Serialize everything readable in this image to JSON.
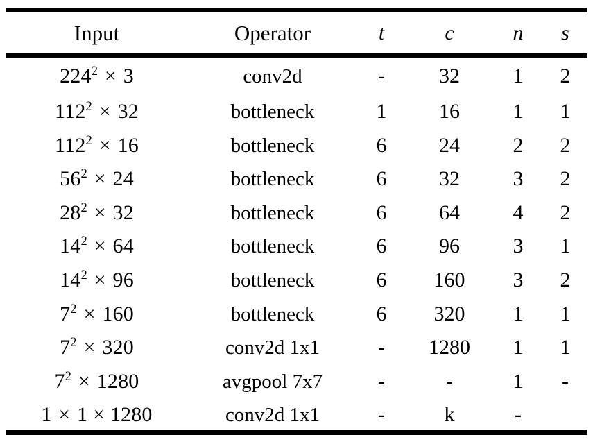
{
  "figure": {
    "kind": "architecture-table",
    "caption": ""
  },
  "table": {
    "columns": [
      {
        "key": "input",
        "label": "Input",
        "style": "roman"
      },
      {
        "key": "operator",
        "label": "Operator",
        "style": "roman"
      },
      {
        "key": "t",
        "label": "t",
        "style": "italic"
      },
      {
        "key": "c",
        "label": "c",
        "style": "italic"
      },
      {
        "key": "n",
        "label": "n",
        "style": "italic"
      },
      {
        "key": "s",
        "label": "s",
        "style": "italic"
      }
    ],
    "rows": [
      {
        "input_base": "224",
        "input_exp": "2",
        "input_mul": "3",
        "input_text": "224² × 3",
        "operator": "conv2d",
        "t": "-",
        "c": "32",
        "n": "1",
        "s": "2"
      },
      {
        "input_base": "112",
        "input_exp": "2",
        "input_mul": "32",
        "input_text": "112² × 32",
        "operator": "bottleneck",
        "t": "1",
        "c": "16",
        "n": "1",
        "s": "1"
      },
      {
        "input_base": "112",
        "input_exp": "2",
        "input_mul": "16",
        "input_text": "112² × 16",
        "operator": "bottleneck",
        "t": "6",
        "c": "24",
        "n": "2",
        "s": "2"
      },
      {
        "input_base": "56",
        "input_exp": "2",
        "input_mul": "24",
        "input_text": "56² × 24",
        "operator": "bottleneck",
        "t": "6",
        "c": "32",
        "n": "3",
        "s": "2"
      },
      {
        "input_base": "28",
        "input_exp": "2",
        "input_mul": "32",
        "input_text": "28² × 32",
        "operator": "bottleneck",
        "t": "6",
        "c": "64",
        "n": "4",
        "s": "2"
      },
      {
        "input_base": "14",
        "input_exp": "2",
        "input_mul": "64",
        "input_text": "14² × 64",
        "operator": "bottleneck",
        "t": "6",
        "c": "96",
        "n": "3",
        "s": "1"
      },
      {
        "input_base": "14",
        "input_exp": "2",
        "input_mul": "96",
        "input_text": "14² × 96",
        "operator": "bottleneck",
        "t": "6",
        "c": "160",
        "n": "3",
        "s": "2"
      },
      {
        "input_base": "7",
        "input_exp": "2",
        "input_mul": "160",
        "input_text": "7² × 160",
        "operator": "bottleneck",
        "t": "6",
        "c": "320",
        "n": "1",
        "s": "1"
      },
      {
        "input_base": "7",
        "input_exp": "2",
        "input_mul": "320",
        "input_text": "7² × 320",
        "operator": "conv2d 1x1",
        "t": "-",
        "c": "1280",
        "n": "1",
        "s": "1"
      },
      {
        "input_base": "7",
        "input_exp": "2",
        "input_mul": "1280",
        "input_text": "7² × 1280",
        "operator": "avgpool 7x7",
        "t": "-",
        "c": "-",
        "n": "1",
        "s": "-"
      },
      {
        "input_base": "1",
        "input_exp": "",
        "input_mul": "1 × 1280",
        "input_text": "1 × 1 × 1280",
        "operator": "conv2d 1x1",
        "t": "-",
        "c": "k",
        "n": "-",
        "s": ""
      }
    ]
  },
  "symbols": {
    "times": "×",
    "dash": "-"
  },
  "colors": {
    "rule": "#000000",
    "text": "#000000",
    "background": "#ffffff"
  }
}
